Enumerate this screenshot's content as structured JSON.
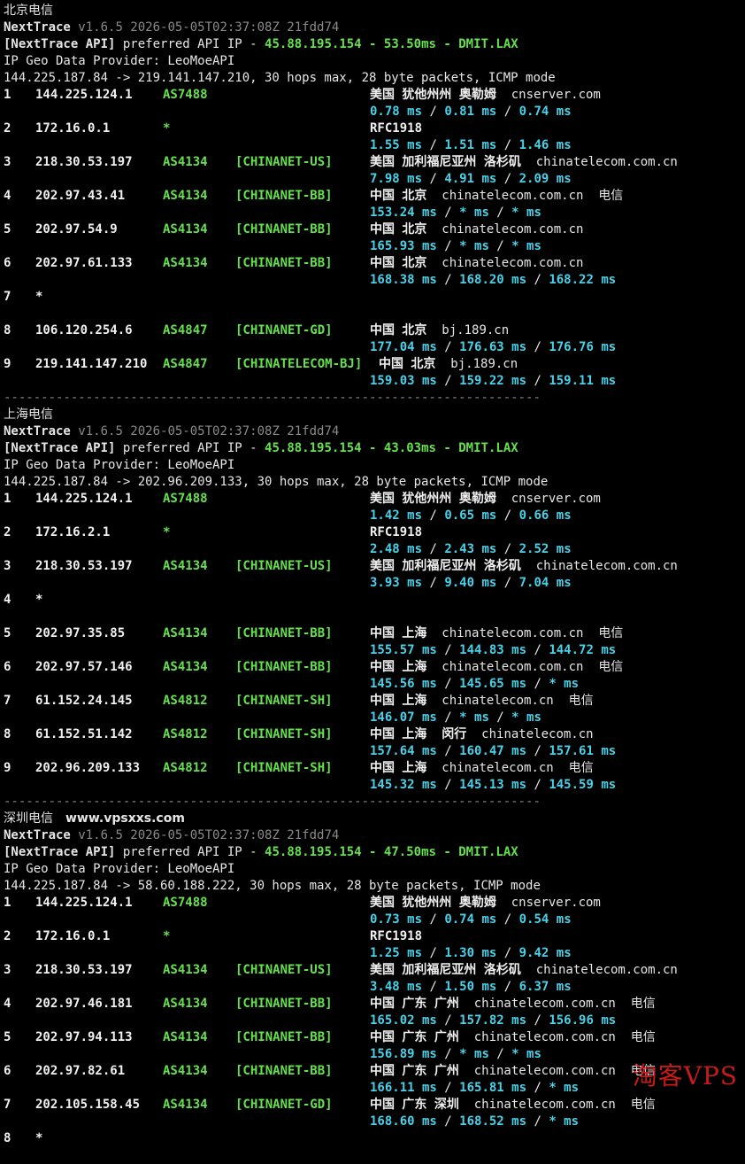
{
  "sections": [
    {
      "title": "北京电信",
      "site": "",
      "version": "v1.6.5 2026-05-05T02:37:08Z 21fdd74",
      "api_ip": "45.88.195.154",
      "api_latency": "53.50ms",
      "api_pop": "DMIT.LAX",
      "route": "144.225.187.84 -> 219.141.147.210, 30 hops max, 28 byte packets, ICMP mode",
      "hops": [
        {
          "n": "1",
          "ip": "144.225.124.1",
          "as": "AS7488",
          "tag": "",
          "geo": "美国 犹他州州 奥勒姆",
          "host": "cnserver.com",
          "isp": "",
          "rtt": [
            "0.78 ms",
            "0.81 ms",
            "0.74 ms"
          ]
        },
        {
          "n": "2",
          "ip": "172.16.0.1",
          "as": "*",
          "tag": "",
          "geo": "RFC1918",
          "host": "",
          "isp": "",
          "rtt": [
            "1.55 ms",
            "1.51 ms",
            "1.46 ms"
          ]
        },
        {
          "n": "3",
          "ip": "218.30.53.197",
          "as": "AS4134",
          "tag": "[CHINANET-US]",
          "geo": "美国 加利福尼亚州 洛杉矶",
          "host": "chinatelecom.com.cn",
          "isp": "",
          "rtt": [
            "7.98 ms",
            "4.91 ms",
            "2.09 ms"
          ]
        },
        {
          "n": "4",
          "ip": "202.97.43.41",
          "as": "AS4134",
          "tag": "[CHINANET-BB]",
          "geo": "中国 北京",
          "host": "chinatelecom.com.cn",
          "isp": "电信",
          "rtt": [
            "153.24 ms",
            "* ms",
            "* ms"
          ]
        },
        {
          "n": "5",
          "ip": "202.97.54.9",
          "as": "AS4134",
          "tag": "[CHINANET-BB]",
          "geo": "中国 北京",
          "host": "chinatelecom.com.cn",
          "isp": "",
          "rtt": [
            "165.93 ms",
            "* ms",
            "* ms"
          ]
        },
        {
          "n": "6",
          "ip": "202.97.61.133",
          "as": "AS4134",
          "tag": "[CHINANET-BB]",
          "geo": "中国 北京",
          "host": "chinatelecom.com.cn",
          "isp": "",
          "rtt": [
            "168.38 ms",
            "168.20 ms",
            "168.22 ms"
          ]
        },
        {
          "n": "7",
          "ip": "*",
          "as": "",
          "tag": "",
          "geo": "",
          "host": "",
          "isp": "",
          "rtt": []
        },
        {
          "n": "8",
          "ip": "106.120.254.6",
          "as": "AS4847",
          "tag": "[CHINANET-GD]",
          "geo": "中国 北京",
          "host": "bj.189.cn",
          "isp": "",
          "rtt": [
            "177.04 ms",
            "176.63 ms",
            "176.76 ms"
          ]
        },
        {
          "n": "9",
          "ip": "219.141.147.210",
          "as": "AS4847",
          "tag": "[CHINATELECOM-BJ]",
          "geo": "中国 北京",
          "host": "bj.189.cn",
          "isp": "",
          "geo_shift": true,
          "rtt": [
            "159.03 ms",
            "159.22 ms",
            "159.11 ms"
          ]
        }
      ]
    },
    {
      "title": "上海电信",
      "site": "",
      "version": "v1.6.5 2026-05-05T02:37:08Z 21fdd74",
      "api_ip": "45.88.195.154",
      "api_latency": "43.03ms",
      "api_pop": "DMIT.LAX",
      "route": "144.225.187.84 -> 202.96.209.133, 30 hops max, 28 byte packets, ICMP mode",
      "hops": [
        {
          "n": "1",
          "ip": "144.225.124.1",
          "as": "AS7488",
          "tag": "",
          "geo": "美国 犹他州州 奥勒姆",
          "host": "cnserver.com",
          "isp": "",
          "rtt": [
            "1.42 ms",
            "0.65 ms",
            "0.66 ms"
          ]
        },
        {
          "n": "2",
          "ip": "172.16.2.1",
          "as": "*",
          "tag": "",
          "geo": "RFC1918",
          "host": "",
          "isp": "",
          "rtt": [
            "2.48 ms",
            "2.43 ms",
            "2.52 ms"
          ]
        },
        {
          "n": "3",
          "ip": "218.30.53.197",
          "as": "AS4134",
          "tag": "[CHINANET-US]",
          "geo": "美国 加利福尼亚州 洛杉矶",
          "host": "chinatelecom.com.cn",
          "isp": "",
          "rtt": [
            "3.93 ms",
            "9.40 ms",
            "7.04 ms"
          ]
        },
        {
          "n": "4",
          "ip": "*",
          "as": "",
          "tag": "",
          "geo": "",
          "host": "",
          "isp": "",
          "rtt": []
        },
        {
          "n": "5",
          "ip": "202.97.35.85",
          "as": "AS4134",
          "tag": "[CHINANET-BB]",
          "geo": "中国 上海",
          "host": "chinatelecom.com.cn",
          "isp": "电信",
          "rtt": [
            "155.57 ms",
            "144.83 ms",
            "144.72 ms"
          ]
        },
        {
          "n": "6",
          "ip": "202.97.57.146",
          "as": "AS4134",
          "tag": "[CHINANET-BB]",
          "geo": "中国 上海",
          "host": "chinatelecom.com.cn",
          "isp": "电信",
          "rtt": [
            "145.56 ms",
            "145.65 ms",
            "* ms"
          ]
        },
        {
          "n": "7",
          "ip": "61.152.24.145",
          "as": "AS4812",
          "tag": "[CHINANET-SH]",
          "geo": "中国 上海",
          "host": "chinatelecom.cn",
          "isp": "电信",
          "rtt": [
            "146.07 ms",
            "* ms",
            "* ms"
          ]
        },
        {
          "n": "8",
          "ip": "61.152.51.142",
          "as": "AS4812",
          "tag": "[CHINANET-SH]",
          "geo": "中国 上海  闵行",
          "host": "chinatelecom.cn",
          "isp": "",
          "rtt": [
            "157.64 ms",
            "160.47 ms",
            "157.61 ms"
          ]
        },
        {
          "n": "9",
          "ip": "202.96.209.133",
          "as": "AS4812",
          "tag": "[CHINANET-SH]",
          "geo": "中国 上海",
          "host": "chinatelecom.cn",
          "isp": "电信",
          "rtt": [
            "145.32 ms",
            "145.13 ms",
            "145.59 ms"
          ]
        }
      ]
    },
    {
      "title": "深圳电信",
      "site": "www.vpsxxs.com",
      "version": "v1.6.5 2026-05-05T02:37:08Z 21fdd74",
      "api_ip": "45.88.195.154",
      "api_latency": "47.50ms",
      "api_pop": "DMIT.LAX",
      "route": "144.225.187.84 -> 58.60.188.222, 30 hops max, 28 byte packets, ICMP mode",
      "hops": [
        {
          "n": "1",
          "ip": "144.225.124.1",
          "as": "AS7488",
          "tag": "",
          "geo": "美国 犹他州州 奥勒姆",
          "host": "cnserver.com",
          "isp": "",
          "rtt": [
            "0.73 ms",
            "0.74 ms",
            "0.54 ms"
          ]
        },
        {
          "n": "2",
          "ip": "172.16.0.1",
          "as": "*",
          "tag": "",
          "geo": "RFC1918",
          "host": "",
          "isp": "",
          "rtt": [
            "1.25 ms",
            "1.30 ms",
            "9.42 ms"
          ]
        },
        {
          "n": "3",
          "ip": "218.30.53.197",
          "as": "AS4134",
          "tag": "[CHINANET-US]",
          "geo": "美国 加利福尼亚州 洛杉矶",
          "host": "chinatelecom.com.cn",
          "isp": "",
          "rtt": [
            "3.48 ms",
            "1.50 ms",
            "6.37 ms"
          ]
        },
        {
          "n": "4",
          "ip": "202.97.46.181",
          "as": "AS4134",
          "tag": "[CHINANET-BB]",
          "geo": "中国 广东 广州",
          "host": "chinatelecom.com.cn",
          "isp": "电信",
          "rtt": [
            "165.02 ms",
            "157.82 ms",
            "156.96 ms"
          ]
        },
        {
          "n": "5",
          "ip": "202.97.94.113",
          "as": "AS4134",
          "tag": "[CHINANET-BB]",
          "geo": "中国 广东 广州",
          "host": "chinatelecom.com.cn",
          "isp": "电信",
          "rtt": [
            "156.89 ms",
            "* ms",
            "* ms"
          ]
        },
        {
          "n": "6",
          "ip": "202.97.82.61",
          "as": "AS4134",
          "tag": "[CHINANET-BB]",
          "geo": "中国 广东 广州",
          "host": "chinatelecom.com.cn",
          "isp": "电信",
          "rtt": [
            "166.11 ms",
            "165.81 ms",
            "* ms"
          ]
        },
        {
          "n": "7",
          "ip": "202.105.158.45",
          "as": "AS4134",
          "tag": "[CHINANET-GD]",
          "geo": "中国 广东 深圳",
          "host": "chinatelecom.com.cn",
          "isp": "电信",
          "rtt": [
            "168.60 ms",
            "168.52 ms",
            "* ms"
          ]
        },
        {
          "n": "8",
          "ip": "*",
          "as": "",
          "tag": "",
          "geo": "",
          "host": "",
          "isp": "",
          "rtt": []
        }
      ]
    }
  ],
  "separator": "------------------------------------------------------------------------",
  "labels": {
    "app": "NextTrace",
    "api_tag": "[NextTrace API]",
    "preferred": "preferred API IP -",
    "dash": "-",
    "geo_provider": "IP Geo Data Provider: LeoMoeAPI"
  },
  "watermark": "淘客VPS",
  "colors": {
    "background": "#000000",
    "green": "#66e04e",
    "cyan": "#48d1e8",
    "grey": "#8a8a8a",
    "watermark": "#d81e1e"
  }
}
